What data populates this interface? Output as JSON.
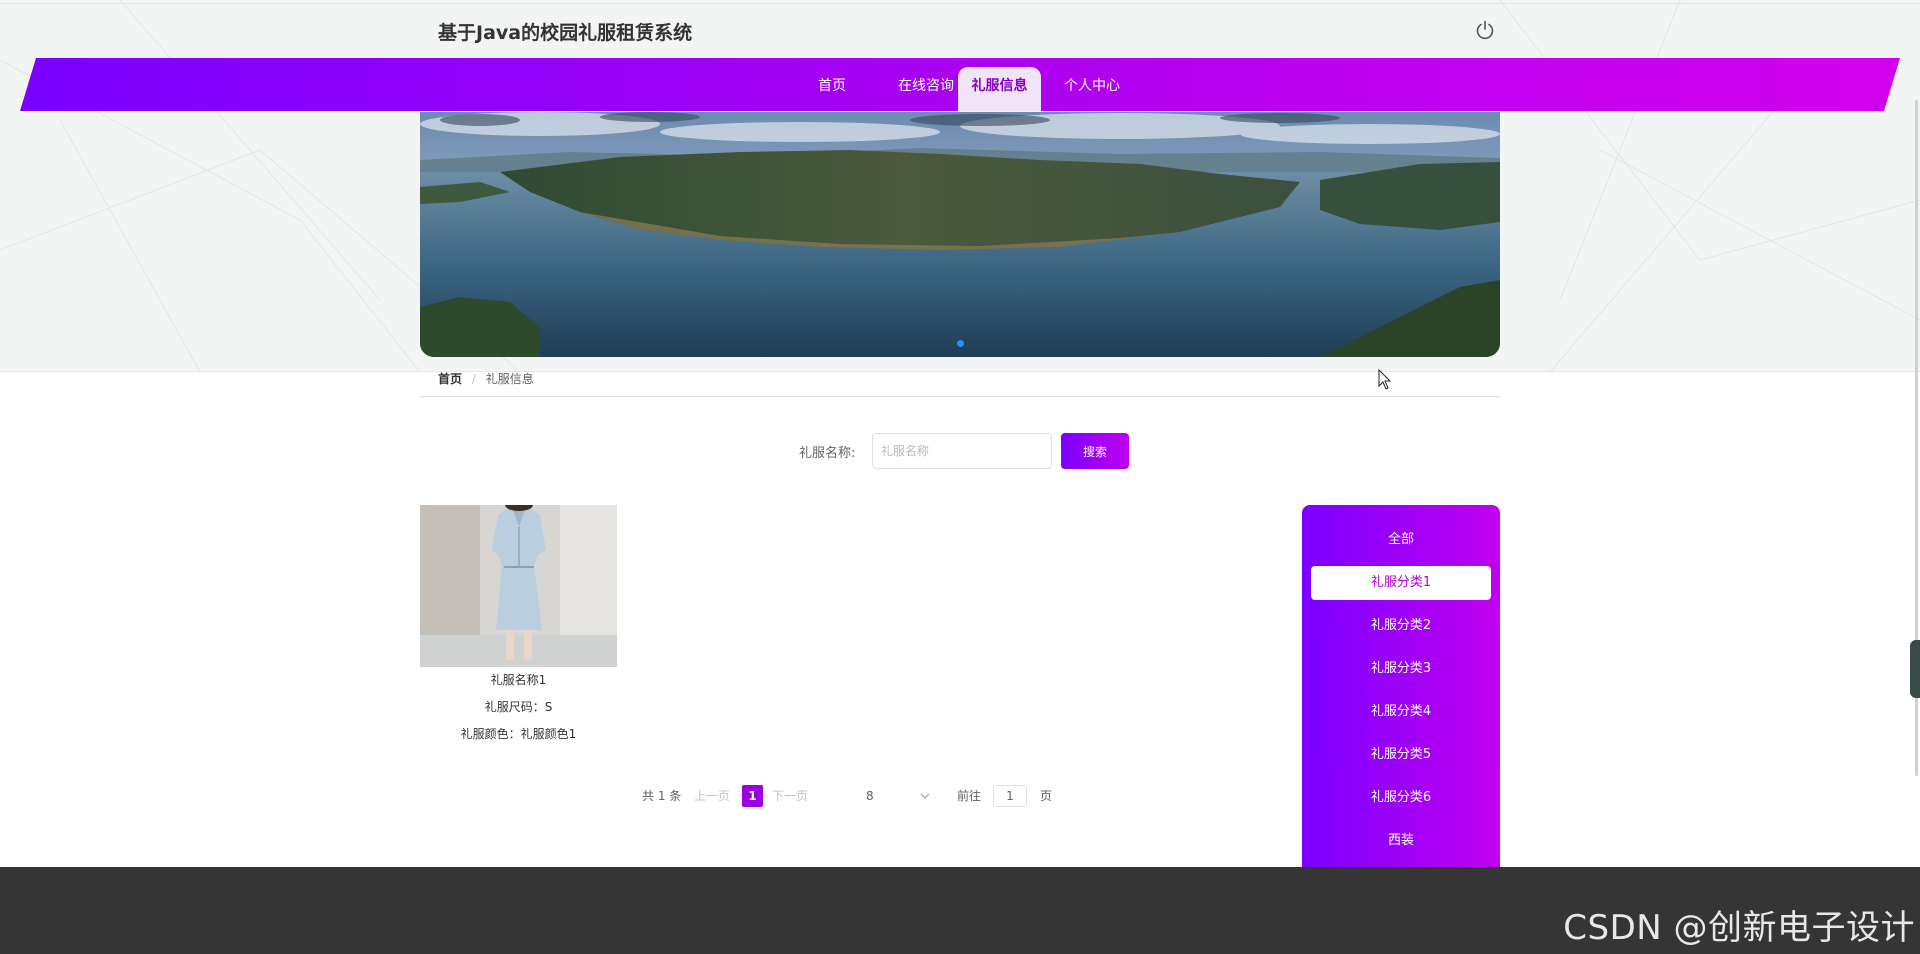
{
  "header": {
    "title": "基于Java的校园礼服租赁系统",
    "power_icon": "power-icon"
  },
  "nav": {
    "items": [
      {
        "label": "首页"
      },
      {
        "label": "在线咨询"
      },
      {
        "label": "礼服信息"
      },
      {
        "label": "个人中心"
      }
    ],
    "active_index": 2,
    "gradient": [
      "#7a00ff",
      "#d200ee"
    ]
  },
  "banner": {
    "image": "mountain-lake-landscape",
    "slide_count": 1,
    "active_slide": 0
  },
  "breadcrumb": {
    "home": "首页",
    "separator": "/",
    "current": "礼服信息"
  },
  "search": {
    "label": "礼服名称:",
    "placeholder": "礼服名称",
    "value": "",
    "button": "搜索"
  },
  "products": [
    {
      "name": "礼服名称1",
      "size_line": "礼服尺码：S",
      "color_line": "礼服颜色：礼服颜色1",
      "image": "light-blue-dress-photo"
    }
  ],
  "pagination": {
    "total": "共 1 条",
    "prev": "上一页",
    "current_page": "1",
    "next": "下一页",
    "page_size": "8",
    "goto_label": "前往",
    "goto_value": "1",
    "page_unit": "页"
  },
  "categories": {
    "items": [
      "全部",
      "礼服分类1",
      "礼服分类2",
      "礼服分类3",
      "礼服分类4",
      "礼服分类5",
      "礼服分类6",
      "西装"
    ],
    "active_index": 1
  },
  "watermark": "CSDN @创新电子设计",
  "colors": {
    "accent": "#9a00e0",
    "footer": "#353535",
    "active_tab_bg": "#f1e4f6"
  }
}
